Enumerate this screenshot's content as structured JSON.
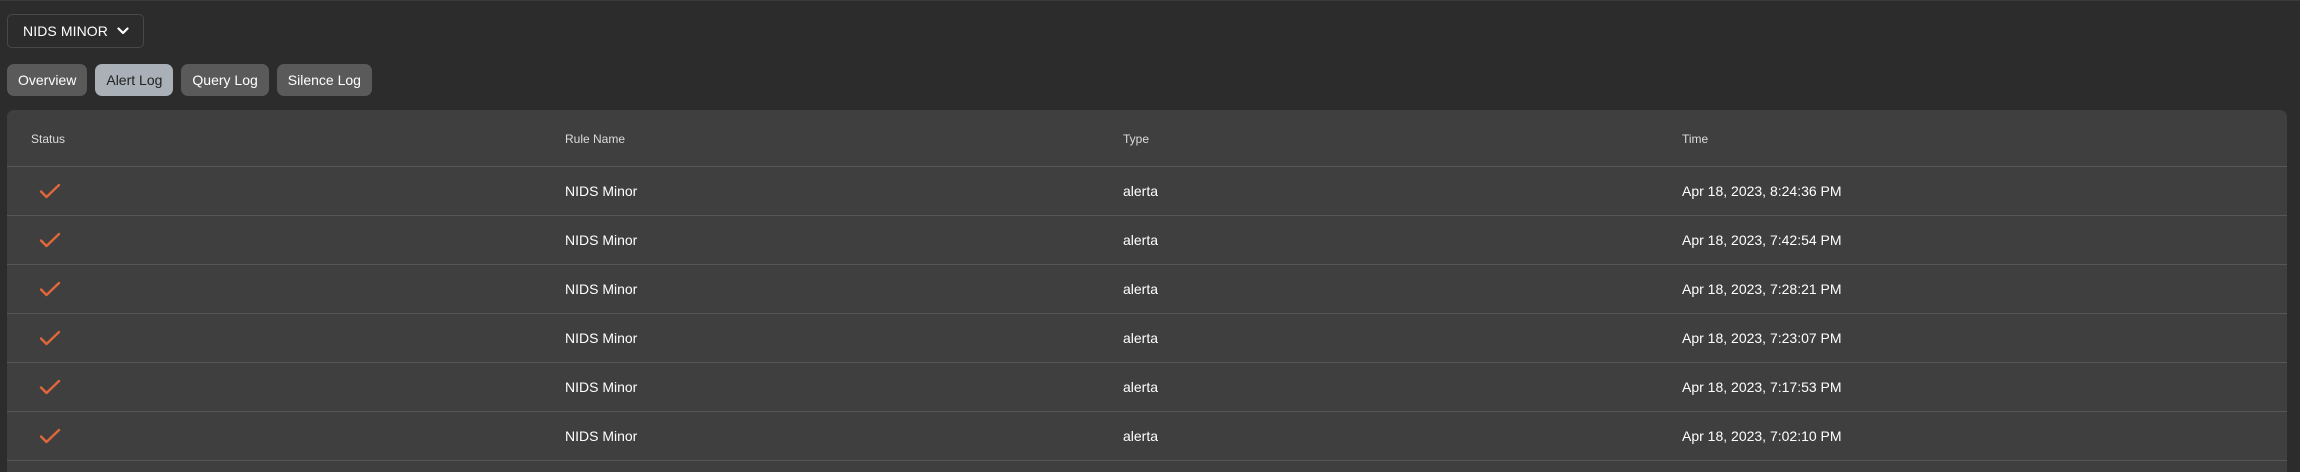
{
  "selector": {
    "label": "NIDS MINOR"
  },
  "tabs": [
    {
      "label": "Overview",
      "active": false
    },
    {
      "label": "Alert Log",
      "active": true
    },
    {
      "label": "Query Log",
      "active": false
    },
    {
      "label": "Silence Log",
      "active": false
    }
  ],
  "table": {
    "headers": {
      "status": "Status",
      "rule_name": "Rule Name",
      "type": "Type",
      "time": "Time"
    },
    "status_icon": "checkmark-icon",
    "accent_color": "#e0673a",
    "rows": [
      {
        "rule_name": "NIDS Minor",
        "type": "alerta",
        "time": "Apr 18, 2023, 8:24:36 PM"
      },
      {
        "rule_name": "NIDS Minor",
        "type": "alerta",
        "time": "Apr 18, 2023, 7:42:54 PM"
      },
      {
        "rule_name": "NIDS Minor",
        "type": "alerta",
        "time": "Apr 18, 2023, 7:28:21 PM"
      },
      {
        "rule_name": "NIDS Minor",
        "type": "alerta",
        "time": "Apr 18, 2023, 7:23:07 PM"
      },
      {
        "rule_name": "NIDS Minor",
        "type": "alerta",
        "time": "Apr 18, 2023, 7:17:53 PM"
      },
      {
        "rule_name": "NIDS Minor",
        "type": "alerta",
        "time": "Apr 18, 2023, 7:02:10 PM"
      }
    ]
  }
}
